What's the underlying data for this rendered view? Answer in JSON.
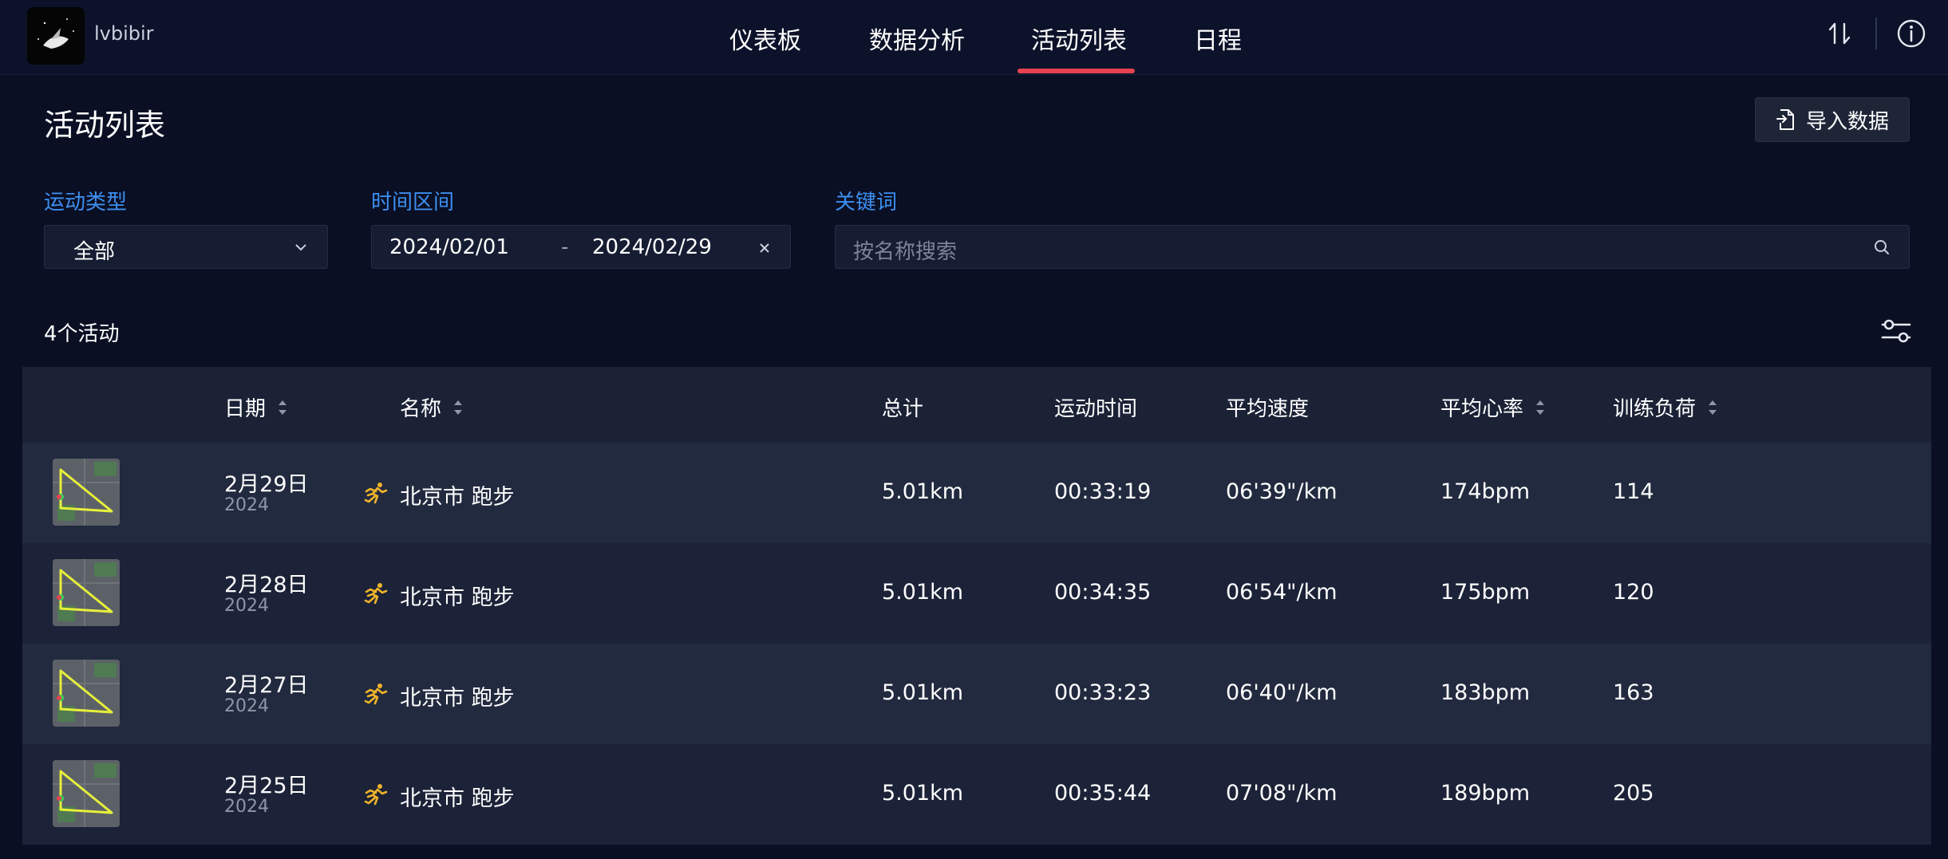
{
  "header": {
    "username": "lvbibir",
    "nav": [
      {
        "label": "仪表板",
        "active": false
      },
      {
        "label": "数据分析",
        "active": false
      },
      {
        "label": "活动列表",
        "active": true
      },
      {
        "label": "日程",
        "active": false
      }
    ],
    "icons": [
      "sort-arrows-icon",
      "info-icon"
    ]
  },
  "page": {
    "title": "活动列表",
    "import_label": "导入数据"
  },
  "filters": {
    "type_label": "运动类型",
    "type_value": "全部",
    "range_label": "时间区间",
    "range_start": "2024/02/01",
    "range_sep": "-",
    "range_end": "2024/02/29",
    "keyword_label": "关键词",
    "keyword_placeholder": "按名称搜索"
  },
  "summary": {
    "count": "4个活动"
  },
  "table": {
    "columns": [
      "日期",
      "名称",
      "总计",
      "运动时间",
      "平均速度",
      "平均心率",
      "训练负荷"
    ],
    "rows": [
      {
        "date": "2月29日",
        "year": "2024",
        "name": "北京市 跑步",
        "total": "5.01km",
        "time": "00:33:19",
        "pace": "06'39\"/km",
        "hr": "174bpm",
        "load": "114"
      },
      {
        "date": "2月28日",
        "year": "2024",
        "name": "北京市 跑步",
        "total": "5.01km",
        "time": "00:34:35",
        "pace": "06'54\"/km",
        "hr": "175bpm",
        "load": "120"
      },
      {
        "date": "2月27日",
        "year": "2024",
        "name": "北京市 跑步",
        "total": "5.01km",
        "time": "00:33:23",
        "pace": "06'40\"/km",
        "hr": "183bpm",
        "load": "163"
      },
      {
        "date": "2月25日",
        "year": "2024",
        "name": "北京市 跑步",
        "total": "5.01km",
        "time": "00:35:44",
        "pace": "07'08\"/km",
        "hr": "189bpm",
        "load": "205"
      }
    ]
  },
  "colors": {
    "accent": "#3d8ff0",
    "active_tab": "#e8424f",
    "run_icon": "#f0b429",
    "route": "#e6f03a"
  }
}
